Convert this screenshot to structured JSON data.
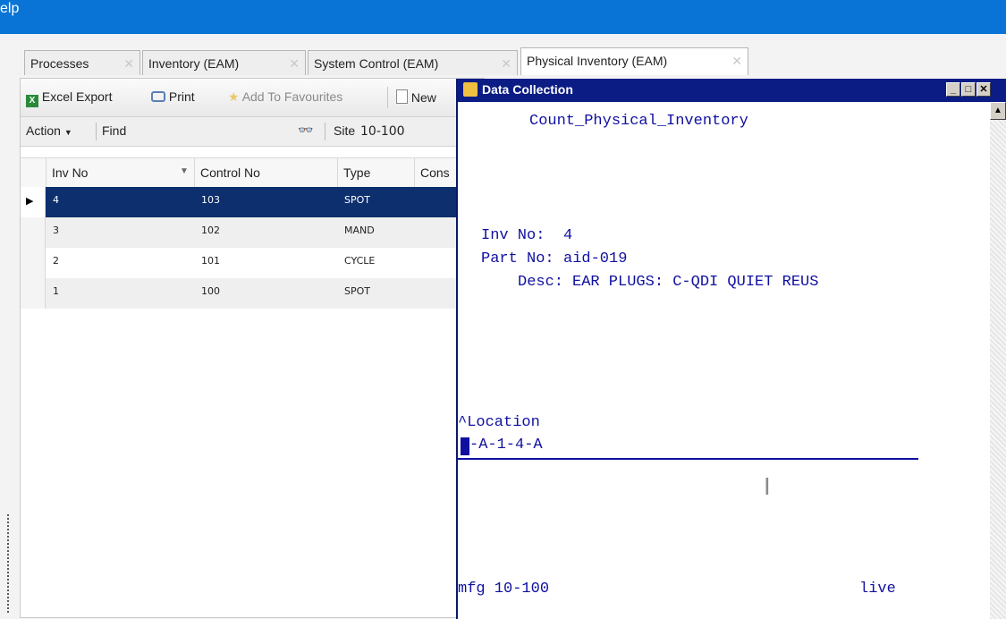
{
  "menubar": {
    "partial_menu": "elp"
  },
  "tabs": [
    {
      "label": "Processes",
      "close": "✕"
    },
    {
      "label": "Inventory (EAM)",
      "close": "✕"
    },
    {
      "label": "System Control (EAM)",
      "close": "✕"
    },
    {
      "label": "Physical Inventory (EAM)",
      "close": "✕"
    }
  ],
  "toolbar": {
    "excel_export": "Excel Export",
    "print": "Print",
    "add_favourites": "Add To Favourites",
    "new": "New"
  },
  "actionbar": {
    "action": "Action",
    "find": "Find",
    "site_label": "Site",
    "site_value": "10-100"
  },
  "grid": {
    "headers": [
      "Inv No",
      "Control No",
      "Type",
      "Cons"
    ],
    "rows": [
      {
        "inv_no": "4",
        "control_no": "103",
        "type": "SPOT"
      },
      {
        "inv_no": "3",
        "control_no": "102",
        "type": "MAND"
      },
      {
        "inv_no": "2",
        "control_no": "101",
        "type": "CYCLE"
      },
      {
        "inv_no": "1",
        "control_no": "100",
        "type": "SPOT"
      }
    ]
  },
  "data_collection": {
    "title": "Data Collection",
    "program": "Count_Physical_Inventory",
    "inv_no_label": "Inv No:",
    "inv_no_value": "4",
    "part_no_label": "Part No:",
    "part_no_value": "aid-019",
    "desc_label": "Desc:",
    "desc_value": "EAR PLUGS: C-QDI QUIET REUS",
    "location_label": "^Location",
    "location_value": "-A-1-4-A",
    "status_left": "mfg 10-100",
    "status_right": "live"
  },
  "colors": {
    "menubar": "#0a74d6",
    "selected_row": "#0d2f6e",
    "terminal_title": "#0b1c84",
    "terminal_text": "#1010a0"
  }
}
